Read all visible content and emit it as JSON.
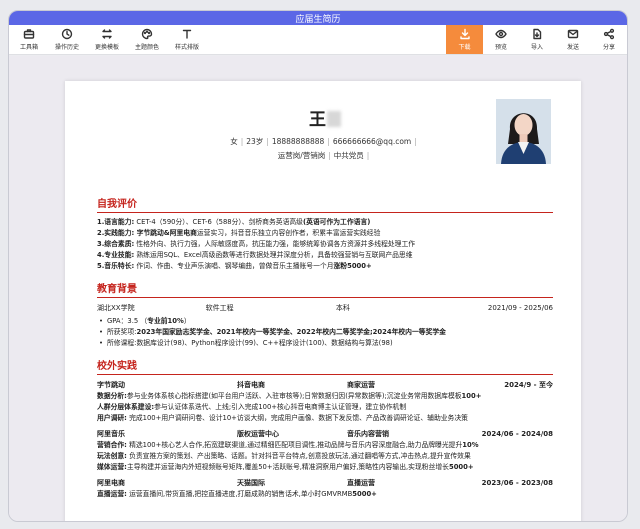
{
  "window": {
    "title": "应届生简历"
  },
  "toolbar": {
    "left": [
      {
        "label": "工具箱",
        "icon": "toolbox-icon"
      },
      {
        "label": "操作历史",
        "icon": "history-icon"
      },
      {
        "label": "更换模板",
        "icon": "template-icon"
      },
      {
        "label": "主题颜色",
        "icon": "palette-icon"
      },
      {
        "label": "样式排版",
        "icon": "text-style-icon"
      }
    ],
    "right": [
      {
        "label": "下载",
        "icon": "download-icon"
      },
      {
        "label": "预览",
        "icon": "eye-icon"
      },
      {
        "label": "导入",
        "icon": "import-icon"
      },
      {
        "label": "发送",
        "icon": "send-icon"
      },
      {
        "label": "分享",
        "icon": "share-icon"
      }
    ],
    "accent_color": "#f58b3c"
  },
  "resume": {
    "name": "王",
    "info1": [
      "女",
      "23岁",
      "18888888888",
      "666666666@qq.com"
    ],
    "info2": [
      "运营岗/营销岗",
      "中共党员"
    ],
    "accent_color": "#c5241d",
    "self_eval": {
      "title": "自我评价",
      "items": [
        {
          "head": "1.语言能力:",
          "body": " CET-4（590分）、CET-6（588分）、剑桥商务英语高级",
          "tail": "(英语可作为工作语言)"
        },
        {
          "head": "2.实践能力: 字节跳动&阿里电商",
          "body": "运营实习，抖音音乐独立内容创作者，积累丰富运营实践经验",
          "tail": ""
        },
        {
          "head": "3.综合素质:",
          "body": " 性格外向、执行力强，人际敏感度高，抗压能力强，能够统筹协调各方资源并多线程处理工作",
          "tail": ""
        },
        {
          "head": "4.专业技能:",
          "body": " 熟练运用SQL、Excel高级函数等进行数据处理并深度分析，具备较强营销与互联网产品思维",
          "tail": ""
        },
        {
          "head": "5.音乐特长:",
          "body": " 作词、作曲、专业声乐演唱、钢琴编曲，曾做音乐主播账号一个月",
          "tail": "涨粉5000+"
        }
      ]
    },
    "education": {
      "title": "教育背景",
      "school": "湖北XX学院",
      "major": "软件工程",
      "degree": "本科",
      "period": "2021/09 - 2025/06",
      "bullets": [
        {
          "text": "GPA：3.5  （",
          "bold": "专业前10%",
          "after": "）"
        },
        {
          "text": "所获奖项:",
          "bold": "2023年国家励志奖学金、2021年校内一等奖学金、2022年校内二等奖学金;2024年校内一等奖学金",
          "after": ""
        },
        {
          "text": "所修课程:数据库设计(98)、Python程序设计(99)、C++程序设计(100)、数据结构与算法(98)",
          "bold": "",
          "after": ""
        }
      ]
    },
    "practice": {
      "title": "校外实践",
      "jobs": [
        {
          "company": "字节跳动",
          "dept": "抖音电商",
          "role": "商家运营",
          "period": "2024/9 - 至今",
          "lines": [
            {
              "head": "数据分析:",
              "body": "参与业务体系核心指标搭建(如平台用户活跃、入驻审核等);日常数据归因(异常数据等);沉淀业务常用数据库模板",
              "tail": "100+"
            },
            {
              "head": "人群分层体系建设:",
              "body": "参与认证体系迭代、上线;引入完成100+核心抖音电商博主认证管理，建立协作机制",
              "tail": ""
            },
            {
              "head": "用户调研:",
              "body": " 完成100+用户调研问卷、设计10+访谈大纲，完成用户画像、数据下发反馈、产品改善调研论证、辅助业务决策",
              "tail": ""
            }
          ]
        },
        {
          "company": "阿里音乐",
          "dept": "版权运营中心",
          "role": "音乐内容营销",
          "period": "2024/06 - 2024/08",
          "lines": [
            {
              "head": "营销合作:",
              "body": " 精选100+核心艺人合作,拓宽建联渠道,通过精细匹配项目调性,推动品牌与音乐内容深度融合,助力品牌曝光提升",
              "tail": "10%"
            },
            {
              "head": "玩法创意:",
              "body": " 负责宣推方案的策划、产出策略、话题。针对抖音平台特点,创意投放玩法,通过翻唱等方式,冲击热点,提升宣传效果",
              "tail": ""
            },
            {
              "head": "媒体运营:",
              "body": "主导构建并运营海内外短视频账号矩阵,覆盖50+活跃账号,精准洞察用户偏好,策略性内容输出,实现粉丝增长",
              "tail": "5000+"
            }
          ]
        },
        {
          "company": "阿里电商",
          "dept": "天猫国际",
          "role": "直播运营",
          "period": "2023/06 - 2023/08",
          "lines": [
            {
              "head": "直播运营:",
              "body": " 运营直播间,带货直播,把控直播进度,打磨成熟的销售话术,单小时GMVRMB",
              "tail": "5000+"
            }
          ]
        }
      ]
    }
  }
}
